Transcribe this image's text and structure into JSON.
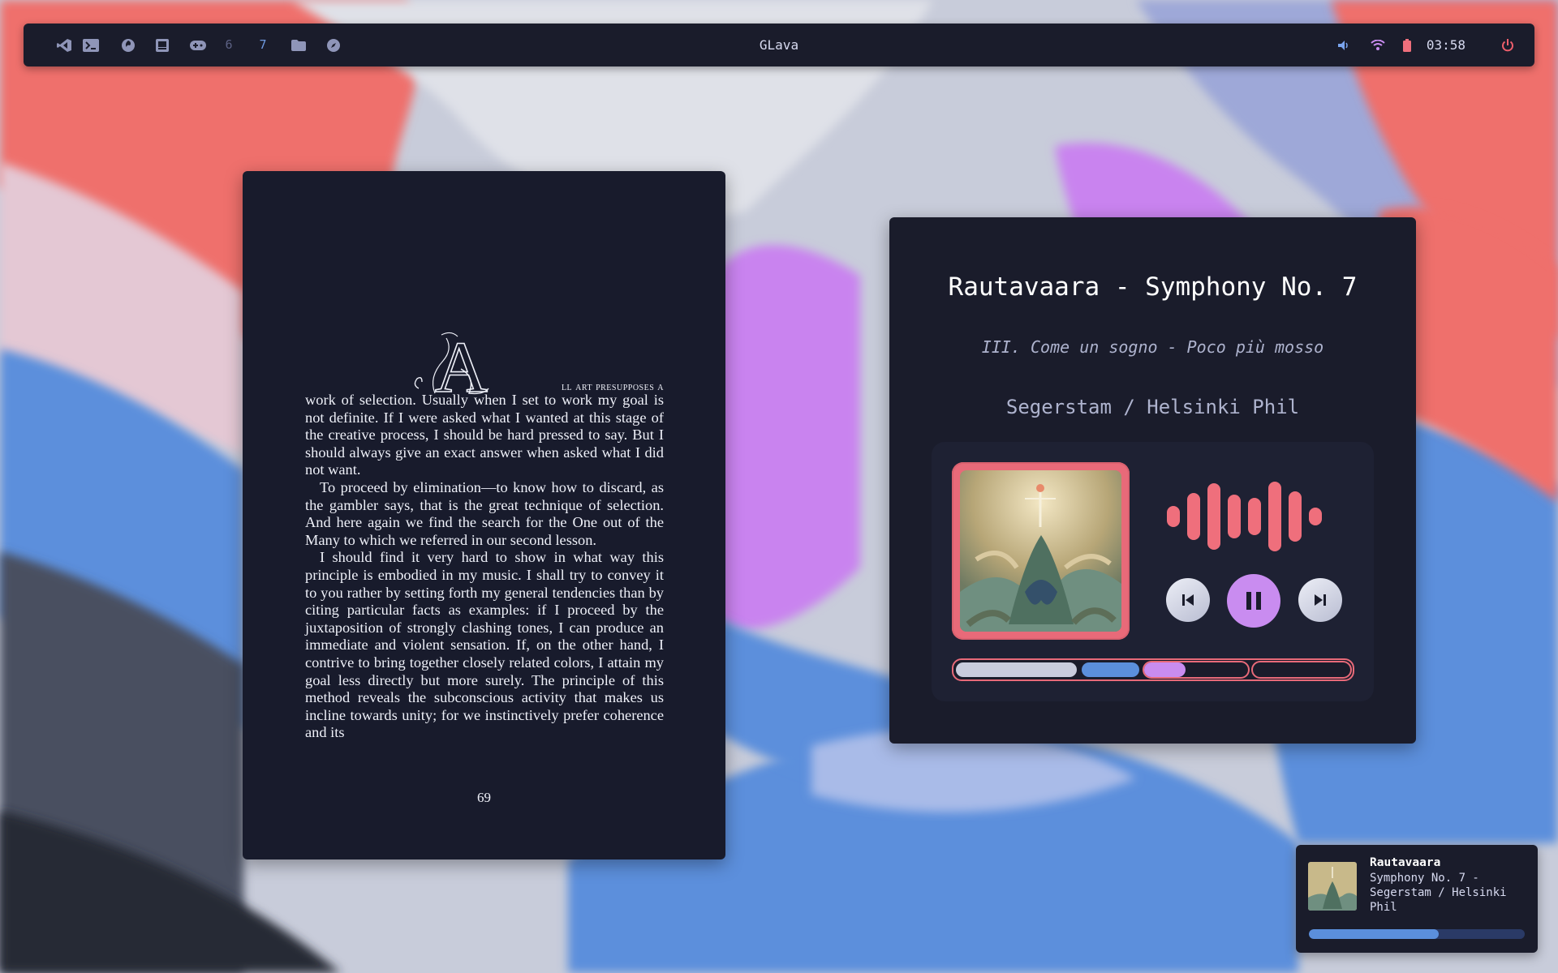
{
  "topbar": {
    "title": "GLava",
    "clock": "03:58",
    "icons": [
      "vscode-icon",
      "terminal-icon",
      "firefox-icon",
      "chat-icon",
      "gamepad-icon"
    ],
    "workspaces": [
      {
        "label": "6",
        "active": false
      },
      {
        "label": "7",
        "active": true
      }
    ],
    "right_icons": [
      "volume-icon",
      "wifi-icon",
      "battery-icon",
      "power-icon"
    ]
  },
  "book": {
    "dropcap_letter": "A",
    "first_line_smallcaps": "ll art presupposes a",
    "paragraphs": [
      "work of selection. Usually when I set to work my goal is not definite. If I were asked what I wanted at this stage of the creative process, I should be hard pressed to say. But I should always give an exact answer when asked what I did not want.",
      "To proceed by elimination—to know how to discard, as the gambler says, that is the great technique of selection. And here again we find the search for the One out of the Many to which we referred in our second lesson.",
      "I should find it very hard to show in what way this principle is embodied in my music. I shall try to convey it to you rather by setting forth my general tendencies than by citing particular facts as examples: if I proceed by the juxtaposition of strongly clashing tones, I can produce an immediate and violent sensation. If, on the other hand, I contrive to bring together closely related colors, I attain my goal less directly but more surely. The principle of this method reveals the subconscious activity that makes us incline towards unity; for we instinctively prefer coherence and its"
    ],
    "page_number": "69"
  },
  "player": {
    "title": "Rautavaara - Symphony No. 7",
    "movement": "III. Come un sogno - Poco più mosso",
    "artist": "Segerstam / Helsinki Phil",
    "is_playing": true,
    "controls": [
      "previous-icon",
      "pause-icon",
      "next-icon"
    ],
    "segment_3_progress": 0.4,
    "colors": {
      "accent": "#e86a79",
      "play": "#c98cf0",
      "blue": "#5b8fdc"
    }
  },
  "notification": {
    "title": "Rautavaara",
    "body": "Symphony No. 7 - Segerstam / Helsinki Phil",
    "progress": 0.6
  }
}
